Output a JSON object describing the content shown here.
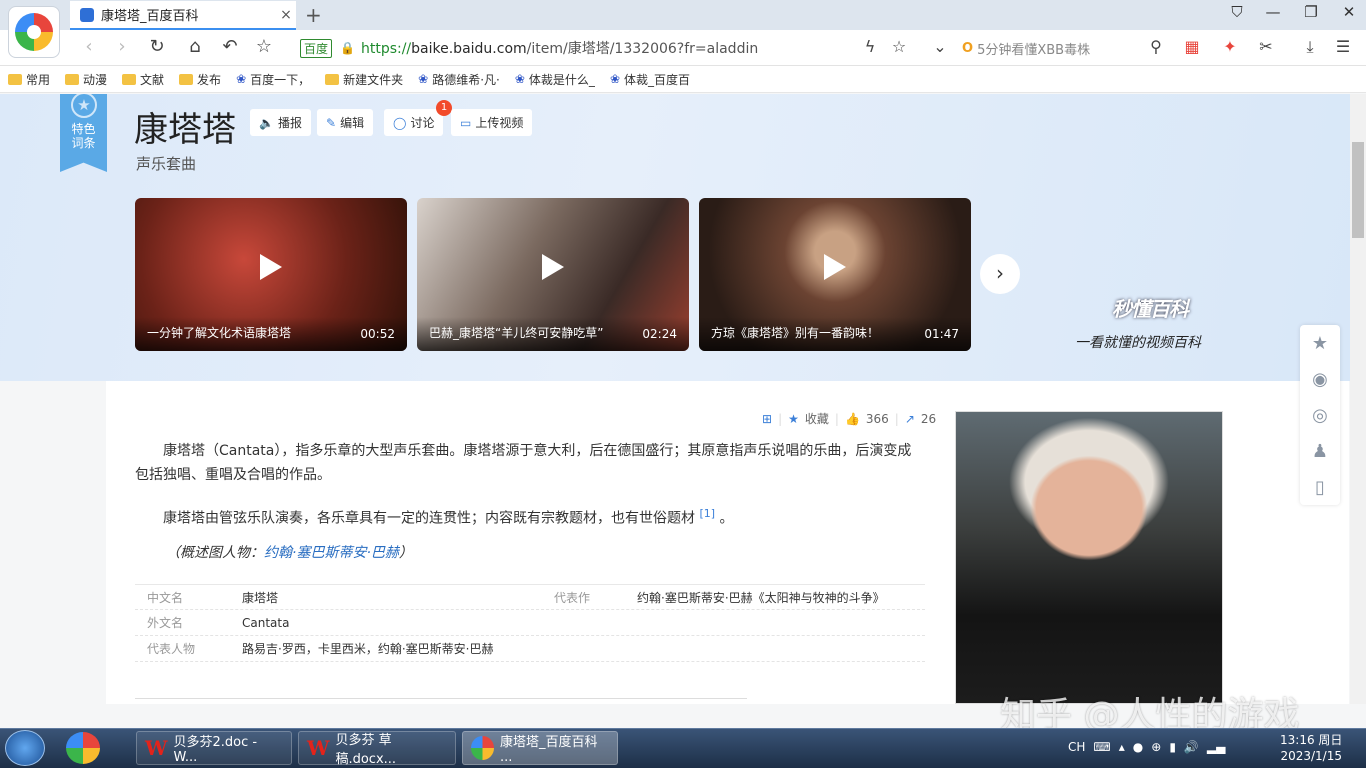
{
  "browser": {
    "tab_title": "康塔塔_百度百科",
    "tab_close": "×",
    "new_tab": "+",
    "url_tag": "百度",
    "url_https": "https://",
    "url_host": "baike.baidu.com",
    "url_path": "/item/康塔塔/1332006?fr=aladdin",
    "search_text": "5分钟看懂XBB毒株",
    "bookmarks": [
      "常用",
      "动漫",
      "文献",
      "发布",
      "百度一下，",
      "新建文件夹",
      "路德维希·凡·",
      "体裁是什么_",
      "体裁_百度百"
    ]
  },
  "page": {
    "ribbon": "特色词条",
    "title": "康塔塔",
    "subtitle": "声乐套曲",
    "buttons": [
      "播报",
      "编辑",
      "讨论",
      "上传视频"
    ],
    "discuss_badge": "1",
    "videos": [
      {
        "caption": "一分钟了解文化术语康塔塔",
        "duration": "00:52"
      },
      {
        "caption": "巴赫_康塔塔“羊儿终可安静吃草”",
        "duration": "02:24"
      },
      {
        "caption": "方琼《康塔塔》别有一番韵味！",
        "duration": "01:47"
      }
    ],
    "video_brand": "秒懂百科",
    "video_slogan": "一看就懂的视频百科",
    "actions": {
      "collect": "收藏",
      "likes": "366",
      "shares": "26"
    },
    "para1": "康塔塔（Cantata），指多乐章的大型声乐套曲。康塔塔源于意大利，后在德国盛行；其原意指声乐说唱的乐曲，后演变成包括独唱、重唱及合唱的作品。",
    "para2": "康塔塔由管弦乐队演奏，各乐章具有一定的连贯性；内容既有宗教题材，也有世俗题材",
    "para2_cite": "[1]",
    "para2_end": "。",
    "caption_prefix": "（概述图人物：",
    "caption_link": "约翰·塞巴斯蒂安·巴赫",
    "caption_suffix": "）",
    "info": {
      "k1": "中文名",
      "v1": "康塔塔",
      "k2": "代表作",
      "v2": "约翰·塞巴斯蒂安·巴赫《太阳神与牧神的斗争》",
      "k3": "外文名",
      "v3": "Cantata",
      "k4": "代表人物",
      "v4_plain": "路易吉·罗西，卡里西米，",
      "v4_link": "约翰·塞巴斯蒂安·巴赫"
    }
  },
  "watermark": "知乎 @人性的游戏",
  "taskbar": {
    "items": [
      "贝多芬2.doc - W...",
      "贝多芬 草稿.docx...",
      "康塔塔_百度百科 ..."
    ],
    "ime": "CH",
    "time": "13:16 周日",
    "date": "2023/1/15"
  }
}
